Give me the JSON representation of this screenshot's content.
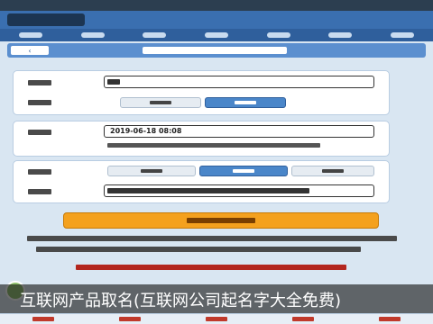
{
  "header": {
    "app_logo_text": "",
    "nav_items": [
      "",
      "",
      "",
      "",
      "",
      "",
      ""
    ]
  },
  "page": {
    "back_label": "‹",
    "title": ""
  },
  "form": {
    "surname_label": "",
    "surname_value": "",
    "gender_label": "",
    "gender_options": [
      {
        "selected": false
      },
      {
        "selected": true
      }
    ],
    "birth_label": "",
    "birth_value": "2019-06-18 08:08",
    "birth_hint": "",
    "length_label": "",
    "length_options": [
      {
        "selected": false
      },
      {
        "selected": true
      },
      {
        "selected": false
      }
    ],
    "char_label": "",
    "char_value": "",
    "submit_label": ""
  },
  "notes": {
    "line1": "",
    "line2": "",
    "line3": ""
  },
  "caption": "互联网产品取名(互联网公司起名字大全免费)",
  "bottom_tabs": [
    "",
    "",
    "",
    "",
    ""
  ],
  "colors": {
    "accent": "#3a6fb0",
    "button": "#f4a11e",
    "warning": "#b3261e"
  }
}
